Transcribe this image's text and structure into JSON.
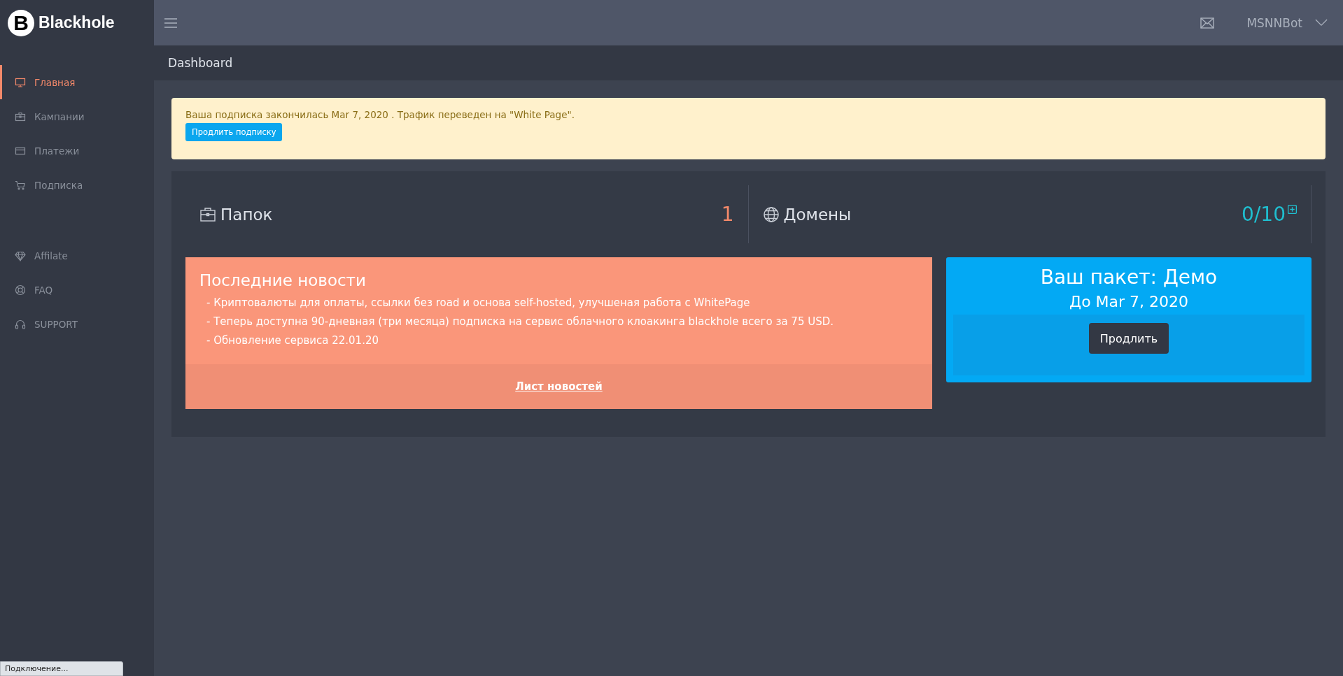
{
  "brand": {
    "logo_letter": "B",
    "name": "Blackhole"
  },
  "sidebar": {
    "groups": [
      {
        "items": [
          {
            "label": "Главная",
            "selected": true
          },
          {
            "label": "Кампании",
            "selected": false
          },
          {
            "label": "Платежи",
            "selected": false
          },
          {
            "label": "Подписка",
            "selected": false
          }
        ]
      },
      {
        "items": [
          {
            "label": "Affilate",
            "selected": false
          },
          {
            "label": "FAQ",
            "selected": false
          },
          {
            "label": "SUPPORT",
            "selected": false
          }
        ]
      }
    ]
  },
  "topbar": {
    "user": "MSNNBot"
  },
  "breadcrumb": "Dashboard",
  "alert": {
    "text": "Ваша подписка закончилась Mar 7, 2020 . Трафик переведен на \"White Page\".",
    "button": "Продлить подписку"
  },
  "stats": [
    {
      "label": "Папок",
      "value": "1",
      "kind": "plain"
    },
    {
      "label": "Домены",
      "value": "0/10",
      "kind": "addable"
    }
  ],
  "news": {
    "title": "Последние новости",
    "items": [
      "- Криптовалюты для оплаты, ссылки без road и основа self-hosted, улучшеная работа с WhitePage",
      "- Теперь доступна 90-дневная (три месяца) подписка на сервис облачного клоакинга blackhole всего за 75 USD.",
      "- Обновление сервиса 22.01.20"
    ],
    "link": "Лист новостей"
  },
  "package": {
    "title": "Ваш пакет: Демо",
    "until": "До Mar 7, 2020",
    "button": "Продлить"
  },
  "status_bar": "Подключение..."
}
